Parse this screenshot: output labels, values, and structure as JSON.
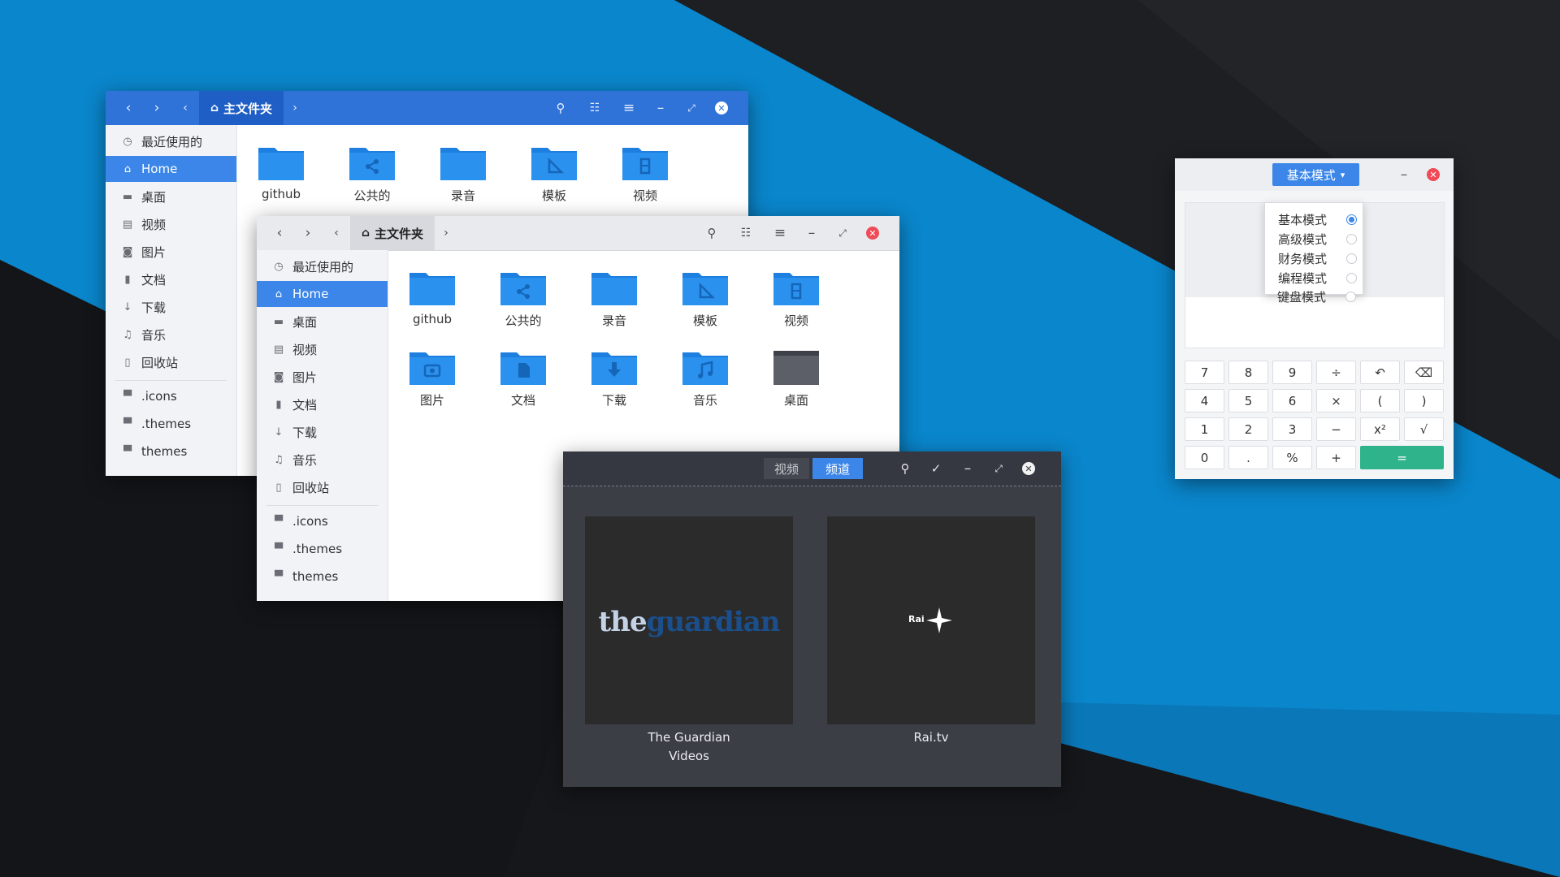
{
  "file_manager": {
    "breadcrumb": "主文件夹",
    "sidebar": {
      "items": [
        {
          "label": "最近使用的",
          "icon": "clock-icon"
        },
        {
          "label": "Home",
          "icon": "home-icon"
        },
        {
          "label": "桌面",
          "icon": "desktop-icon"
        },
        {
          "label": "视频",
          "icon": "film-icon"
        },
        {
          "label": "图片",
          "icon": "camera-icon"
        },
        {
          "label": "文档",
          "icon": "document-icon"
        },
        {
          "label": "下载",
          "icon": "download-icon"
        },
        {
          "label": "音乐",
          "icon": "music-icon"
        },
        {
          "label": "回收站",
          "icon": "trash-icon"
        }
      ],
      "bookmarks": [
        {
          "label": ".icons",
          "icon": "folder-icon"
        },
        {
          "label": ".themes",
          "icon": "folder-icon"
        },
        {
          "label": "themes",
          "icon": "folder-icon"
        }
      ]
    },
    "folders": [
      {
        "label": "github",
        "icon": "plain-folder-icon"
      },
      {
        "label": "公共的",
        "icon": "share-folder-icon"
      },
      {
        "label": "录音",
        "icon": "plain-folder-icon"
      },
      {
        "label": "模板",
        "icon": "template-folder-icon"
      },
      {
        "label": "视频",
        "icon": "video-folder-icon"
      },
      {
        "label": "图片",
        "icon": "pictures-folder-icon"
      },
      {
        "label": "文档",
        "icon": "documents-folder-icon"
      },
      {
        "label": "下载",
        "icon": "downloads-folder-icon"
      },
      {
        "label": "音乐",
        "icon": "music-folder-icon"
      },
      {
        "label": "桌面",
        "icon": "desktop-folder-icon"
      }
    ]
  },
  "video_player": {
    "tabs": [
      "视频",
      "频道"
    ],
    "active_tab": "频道",
    "channels": [
      {
        "label": "The Guardian Videos",
        "logo_the": "the",
        "logo_rest": "guardian"
      },
      {
        "label": "Rai.tv",
        "logo_text": "Rai"
      }
    ]
  },
  "calculator": {
    "mode_button": "基本模式",
    "mode_options": [
      "基本模式",
      "高级模式",
      "财务模式",
      "编程模式",
      "键盘模式"
    ],
    "selected_mode": "基本模式",
    "keys": [
      [
        "7",
        "8",
        "9",
        "÷",
        "↶",
        "⌫"
      ],
      [
        "4",
        "5",
        "6",
        "×",
        "(",
        ")"
      ],
      [
        "1",
        "2",
        "3",
        "−",
        "x²",
        "√"
      ],
      [
        "0",
        ".",
        "%",
        "+",
        "="
      ]
    ]
  },
  "colors": {
    "accent": "#3b86e8",
    "calc_equals": "#2fb38a",
    "close_red": "#ef4a55",
    "wallpaper_blue": "#0a86cc"
  }
}
